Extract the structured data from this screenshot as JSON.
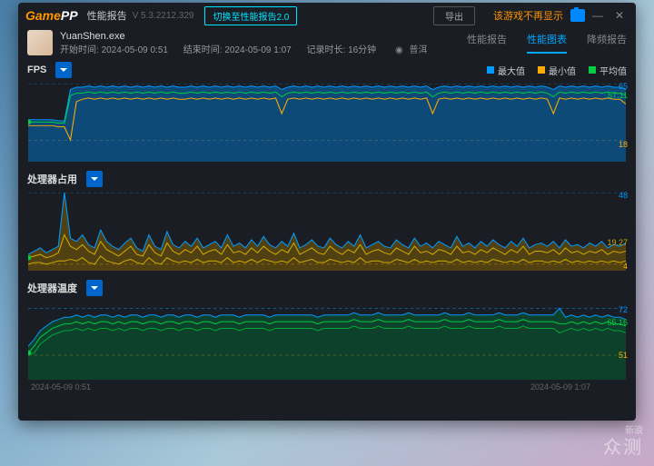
{
  "app": {
    "logo_g": "Game",
    "logo_pp": "PP",
    "title": "性能报告",
    "version": "V 5.3.2212.329",
    "switch": "切换至性能报告2.0",
    "export": "导出",
    "warn": "该游戏不再显示"
  },
  "session": {
    "exe": "YuanShen.exe",
    "start_label": "开始时间:",
    "start": "2024-05-09 0:51",
    "end_label": "结束时间:",
    "end": "2024-05-09 1:07",
    "dur_label": "记录时长:",
    "dur": "16分钟",
    "loc": "普洱"
  },
  "tabs": {
    "t1": "性能报告",
    "t2": "性能图表",
    "t3": "降频报告"
  },
  "legend": {
    "max": "最大值",
    "min": "最小值",
    "avg": "平均值",
    "c_max": "#0099ff",
    "c_min": "#ffaa00",
    "c_avg": "#00cc44"
  },
  "charts": {
    "fps": {
      "title": "FPS",
      "max": 65,
      "avg": 57.11,
      "min": 18
    },
    "cpu": {
      "title": "处理器占用",
      "max": 48,
      "avg": 19.27,
      "min": 4
    },
    "temp": {
      "title": "处理器温度",
      "max": 72,
      "avg": 65.16,
      "min": 51
    }
  },
  "axis": {
    "start": "2024-05-09 0:51",
    "end": "2024-05-09 1:07"
  },
  "watermark": {
    "l1": "新浪",
    "l2": "众测"
  },
  "chart_data": [
    {
      "type": "line",
      "title": "FPS",
      "series": [
        {
          "name": "最大值",
          "color": "#0099ff",
          "values": [
            35,
            35,
            35,
            35,
            35,
            34,
            34,
            60,
            62,
            62,
            63,
            62,
            63,
            62,
            63,
            62,
            63,
            62,
            63,
            62,
            63,
            62,
            63,
            62,
            63,
            62,
            62,
            63,
            62,
            63,
            62,
            63,
            62,
            63,
            62,
            63,
            62,
            63,
            62,
            63,
            62,
            63,
            60,
            62,
            63,
            62,
            63,
            62,
            63,
            62,
            63,
            62,
            63,
            62,
            63,
            62,
            63,
            62,
            63,
            62,
            63,
            62,
            63,
            62,
            63,
            62,
            63,
            60,
            62,
            63,
            62,
            63,
            62,
            63,
            62,
            63,
            62,
            63,
            62,
            63,
            62,
            63,
            62,
            63,
            62,
            63,
            62,
            60,
            63,
            62,
            63,
            62,
            63,
            62,
            63,
            62,
            63,
            62,
            62,
            60
          ]
        },
        {
          "name": "平均值",
          "color": "#00cc44",
          "values": [
            33,
            33,
            33,
            33,
            33,
            32,
            32,
            55,
            57,
            57,
            58,
            57,
            58,
            57,
            58,
            57,
            58,
            57,
            58,
            57,
            58,
            57,
            58,
            57,
            58,
            57,
            57,
            58,
            57,
            58,
            57,
            58,
            57,
            58,
            57,
            58,
            57,
            58,
            57,
            58,
            57,
            58,
            54,
            57,
            58,
            57,
            58,
            57,
            58,
            57,
            58,
            57,
            58,
            57,
            58,
            57,
            58,
            57,
            58,
            57,
            58,
            57,
            58,
            57,
            58,
            57,
            58,
            54,
            57,
            58,
            57,
            58,
            57,
            58,
            57,
            58,
            57,
            58,
            57,
            58,
            57,
            58,
            57,
            58,
            57,
            58,
            57,
            54,
            58,
            57,
            58,
            57,
            58,
            57,
            58,
            57,
            58,
            57,
            57,
            55
          ]
        },
        {
          "name": "最小值",
          "color": "#ffaa00",
          "values": [
            30,
            30,
            30,
            30,
            30,
            29,
            29,
            18,
            50,
            52,
            53,
            52,
            53,
            52,
            53,
            52,
            53,
            52,
            53,
            52,
            53,
            52,
            53,
            52,
            53,
            52,
            52,
            53,
            52,
            53,
            52,
            53,
            52,
            53,
            52,
            53,
            52,
            53,
            52,
            53,
            52,
            53,
            40,
            52,
            53,
            52,
            53,
            52,
            53,
            52,
            53,
            52,
            53,
            52,
            53,
            52,
            53,
            52,
            53,
            52,
            53,
            52,
            53,
            52,
            53,
            52,
            53,
            40,
            52,
            53,
            52,
            53,
            52,
            53,
            52,
            53,
            52,
            53,
            52,
            53,
            52,
            53,
            52,
            53,
            52,
            53,
            52,
            40,
            53,
            52,
            53,
            52,
            53,
            52,
            53,
            52,
            53,
            52,
            52,
            48
          ]
        }
      ],
      "ylim": [
        0,
        65
      ],
      "xrange": [
        "2024-05-09 0:51",
        "2024-05-09 1:07"
      ]
    },
    {
      "type": "line",
      "title": "处理器占用",
      "series": [
        {
          "name": "最大值",
          "color": "#0099ff",
          "values": [
            10,
            12,
            14,
            11,
            13,
            15,
            48,
            20,
            18,
            22,
            16,
            14,
            25,
            18,
            15,
            13,
            17,
            20,
            14,
            12,
            22,
            15,
            13,
            24,
            16,
            14,
            18,
            15,
            20,
            14,
            16,
            18,
            14,
            22,
            15,
            17,
            14,
            19,
            15,
            21,
            16,
            14,
            18,
            15,
            23,
            14,
            16,
            19,
            15,
            14,
            20,
            16,
            14,
            18,
            15,
            22,
            14,
            16,
            18,
            15,
            14,
            19,
            16,
            14,
            20,
            15,
            17,
            14,
            18,
            16,
            14,
            21,
            15,
            17,
            14,
            18,
            15,
            19,
            16,
            14,
            18,
            15,
            20,
            14,
            16,
            17,
            15,
            18,
            14,
            19,
            15,
            16,
            14,
            17,
            15,
            18,
            14,
            16,
            15,
            17
          ]
        },
        {
          "name": "平均值",
          "color": "#ffaa00",
          "values": [
            8,
            9,
            10,
            8,
            9,
            11,
            22,
            15,
            13,
            16,
            12,
            10,
            18,
            13,
            11,
            9,
            12,
            15,
            10,
            9,
            16,
            11,
            9,
            17,
            12,
            10,
            13,
            11,
            15,
            10,
            12,
            13,
            10,
            16,
            11,
            12,
            10,
            14,
            11,
            15,
            12,
            10,
            13,
            11,
            17,
            10,
            12,
            14,
            11,
            10,
            15,
            12,
            10,
            13,
            11,
            16,
            10,
            12,
            13,
            11,
            10,
            14,
            12,
            10,
            15,
            11,
            12,
            10,
            13,
            12,
            10,
            15,
            11,
            12,
            10,
            13,
            11,
            14,
            12,
            10,
            13,
            11,
            15,
            10,
            12,
            12,
            11,
            13,
            10,
            14,
            11,
            12,
            10,
            12,
            11,
            13,
            10,
            12,
            11,
            12
          ]
        },
        {
          "name": "最小值",
          "color": "#ffaa00",
          "values": [
            4,
            5,
            5,
            4,
            5,
            6,
            6,
            7,
            6,
            8,
            5,
            4,
            9,
            6,
            5,
            4,
            6,
            7,
            5,
            4,
            8,
            5,
            4,
            8,
            6,
            5,
            6,
            5,
            7,
            5,
            6,
            6,
            5,
            8,
            5,
            6,
            5,
            7,
            5,
            7,
            6,
            5,
            6,
            5,
            8,
            5,
            6,
            7,
            5,
            5,
            7,
            6,
            5,
            6,
            5,
            8,
            5,
            6,
            6,
            5,
            5,
            7,
            6,
            5,
            7,
            5,
            6,
            5,
            6,
            6,
            5,
            7,
            5,
            6,
            5,
            6,
            5,
            7,
            6,
            5,
            6,
            5,
            7,
            5,
            6,
            6,
            5,
            6,
            5,
            7,
            5,
            6,
            5,
            6,
            5,
            6,
            5,
            6,
            5,
            6
          ]
        }
      ],
      "ylim": [
        0,
        48
      ],
      "xrange": [
        "2024-05-09 0:51",
        "2024-05-09 1:07"
      ]
    },
    {
      "type": "line",
      "title": "处理器温度",
      "series": [
        {
          "name": "最大值",
          "color": "#0099ff",
          "values": [
            55,
            58,
            62,
            64,
            66,
            67,
            68,
            68,
            69,
            68,
            69,
            68,
            69,
            69,
            68,
            69,
            68,
            69,
            69,
            68,
            69,
            69,
            68,
            69,
            69,
            68,
            69,
            69,
            68,
            69,
            69,
            68,
            69,
            69,
            69,
            68,
            69,
            69,
            69,
            69,
            68,
            69,
            69,
            69,
            69,
            69,
            69,
            69,
            68,
            69,
            69,
            69,
            69,
            69,
            70,
            69,
            69,
            69,
            70,
            69,
            69,
            69,
            69,
            70,
            69,
            69,
            69,
            69,
            69,
            70,
            69,
            69,
            69,
            70,
            69,
            69,
            69,
            69,
            70,
            69,
            69,
            69,
            70,
            69,
            69,
            69,
            69,
            69,
            72,
            68,
            69,
            68,
            69,
            68,
            69,
            68,
            69,
            68,
            68,
            67
          ]
        },
        {
          "name": "平均值",
          "color": "#00cc44",
          "values": [
            52,
            55,
            59,
            61,
            63,
            64,
            65,
            65,
            66,
            65,
            66,
            65,
            66,
            66,
            65,
            66,
            65,
            66,
            66,
            65,
            66,
            66,
            65,
            66,
            66,
            65,
            66,
            66,
            65,
            66,
            66,
            65,
            66,
            66,
            66,
            65,
            66,
            66,
            66,
            66,
            65,
            66,
            66,
            66,
            66,
            66,
            66,
            66,
            65,
            66,
            66,
            66,
            66,
            66,
            67,
            66,
            66,
            66,
            67,
            66,
            66,
            66,
            66,
            67,
            66,
            66,
            66,
            66,
            66,
            67,
            66,
            66,
            66,
            67,
            66,
            66,
            66,
            66,
            67,
            66,
            66,
            66,
            67,
            66,
            66,
            66,
            66,
            66,
            65,
            65,
            66,
            65,
            66,
            65,
            66,
            65,
            66,
            65,
            65,
            64
          ]
        },
        {
          "name": "最小值",
          "color": "#00cc44",
          "values": [
            51,
            52,
            56,
            58,
            60,
            61,
            62,
            62,
            63,
            62,
            63,
            62,
            63,
            63,
            62,
            63,
            62,
            63,
            63,
            62,
            63,
            63,
            62,
            63,
            63,
            62,
            63,
            63,
            62,
            63,
            63,
            62,
            63,
            63,
            63,
            62,
            63,
            63,
            63,
            63,
            62,
            63,
            63,
            63,
            63,
            63,
            63,
            63,
            62,
            63,
            63,
            63,
            63,
            63,
            64,
            63,
            63,
            63,
            64,
            63,
            63,
            63,
            63,
            64,
            63,
            63,
            63,
            63,
            63,
            64,
            63,
            63,
            63,
            64,
            63,
            63,
            63,
            63,
            64,
            63,
            63,
            63,
            64,
            63,
            63,
            63,
            63,
            63,
            61,
            62,
            63,
            62,
            63,
            62,
            63,
            62,
            63,
            62,
            62,
            61
          ]
        }
      ],
      "ylim": [
        40,
        75
      ],
      "xrange": [
        "2024-05-09 0:51",
        "2024-05-09 1:07"
      ]
    }
  ]
}
